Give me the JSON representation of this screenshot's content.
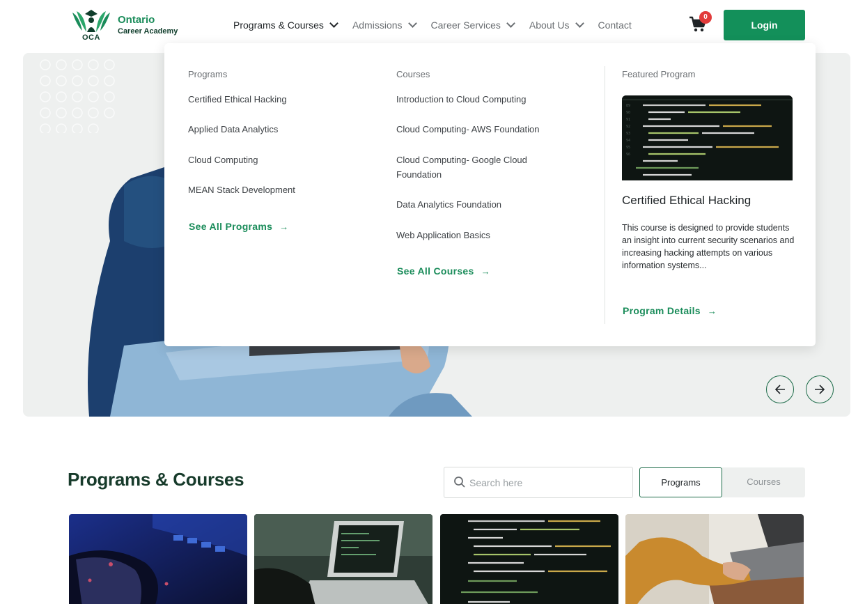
{
  "header": {
    "logo": {
      "name": "Ontario",
      "subtitle": "Career Academy",
      "abbr": "OCA"
    },
    "nav": [
      {
        "label": "Programs & Courses",
        "active": true
      },
      {
        "label": "Admissions",
        "active": false
      },
      {
        "label": "Career Services",
        "active": false
      },
      {
        "label": "About Us",
        "active": false
      },
      {
        "label": "Contact",
        "active": false
      }
    ],
    "cart_count": "0",
    "login_label": "Login"
  },
  "mega_menu": {
    "programs": {
      "heading": "Programs",
      "items": [
        "Certified Ethical Hacking",
        "Applied Data Analytics",
        "Cloud Computing",
        "MEAN Stack Development"
      ],
      "see_all": "See All Programs"
    },
    "courses": {
      "heading": "Courses",
      "items": [
        "Introduction to Cloud Computing",
        "Cloud Computing- AWS Foundation",
        "Cloud Computing- Google Cloud Foundation",
        "Data Analytics Foundation",
        "Web Application Basics"
      ],
      "see_all": "See All Courses"
    },
    "featured": {
      "heading": "Featured Program",
      "title": "Certified Ethical Hacking",
      "description": "This course is designed to provide students an insight into current security scenarios and increasing hacking attempts on various information systems...",
      "details_label": "Program Details"
    }
  },
  "programs_section": {
    "title": "Programs & Courses",
    "search_placeholder": "Search here",
    "tabs": [
      {
        "label": "Programs",
        "selected": true
      },
      {
        "label": "Courses",
        "selected": false
      }
    ]
  },
  "colors": {
    "brand_green": "#13905a",
    "dark_green": "#173b2b",
    "badge_red": "#e23b3b"
  },
  "icons": [
    "cart-icon",
    "chevron-down-icon",
    "arrow-right-icon",
    "arrow-left-icon",
    "search-icon"
  ]
}
